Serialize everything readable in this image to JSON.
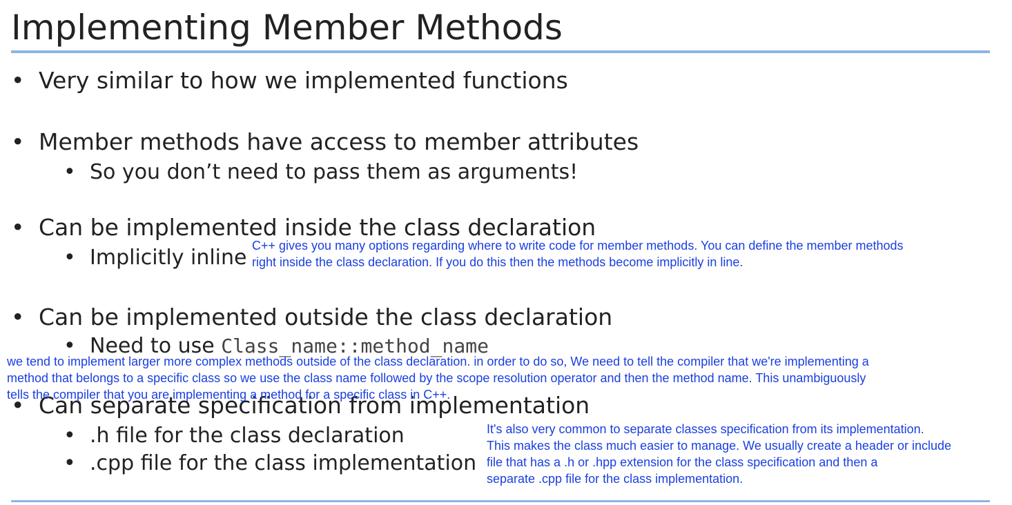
{
  "slide": {
    "title": "Implementing Member Methods"
  },
  "bullets": {
    "b1": "Very similar to how we implemented functions",
    "b2": "Member methods have access to member attributes",
    "b2a": "So you don’t need to pass them as arguments!",
    "b3": "Can be implemented inside the class declaration",
    "b3a": "Implicitly inline",
    "b4": "Can be implemented outside the class declaration",
    "b4a_prefix": "Need to use ",
    "b4a_code": "Class_name::method_name",
    "b5": "Can separate specification from implementation",
    "b5a": ".h file for the class declaration",
    "b5b": ".cpp file for the class implementation"
  },
  "notes": {
    "n1_line1": "C++ gives you many options regarding where to write code for member methods. You can define the member methods",
    "n1_line2": "right inside the class declaration. If you do this then the methods become implicitly in line.",
    "n2_line1": "we tend to implement larger more complex methods outside of the class declaration. in order to do so, We need to tell the compiler that we're implementing a",
    "n2_line2": "method that belongs to a specific class so we use the class name followed by the scope resolution operator and then the method name. This unambiguously",
    "n2_line3": "tells the compiler that you are implementing a method for a specific class in C++.",
    "n3_line1": "It's also very common to separate classes specification from its implementation.",
    "n3_line2": "This makes the class much easier to manage. We usually create a header or include",
    "n3_line3": "file that has a .h or .hpp extension for the class specification and then a",
    "n3_line4": "separate .cpp file for the class implementation."
  },
  "bullet_glyph": "•",
  "colors": {
    "rule": "#8bb5e3",
    "note_text": "#1a3fe0"
  }
}
